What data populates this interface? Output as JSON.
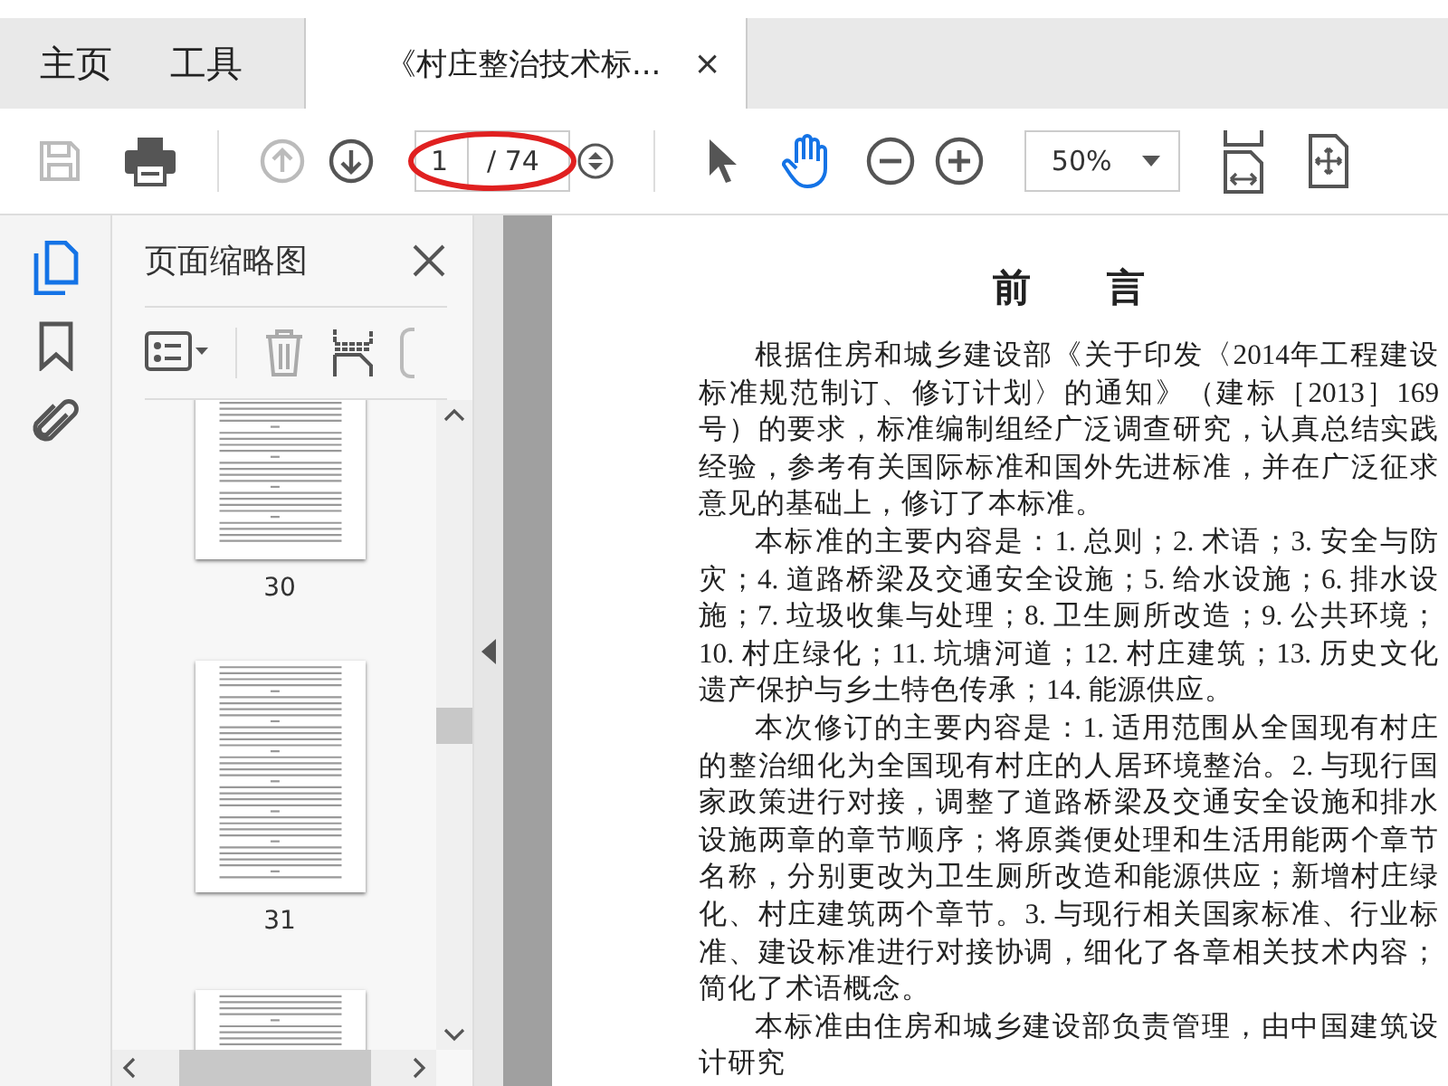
{
  "tabs": [
    {
      "label": "主页",
      "selected": false
    },
    {
      "label": "工具",
      "selected": false
    },
    {
      "label": "《村庄整治技术标...",
      "selected": true,
      "close": "×"
    }
  ],
  "toolbar": {
    "save": {
      "disabled": true
    },
    "prev_page": {
      "disabled": true
    },
    "next_page": {
      "disabled": false
    },
    "page_number": {
      "value": "1"
    },
    "page_count": "/ 74",
    "select_tool": {
      "selected": false
    },
    "hand_tool": {
      "selected": true
    },
    "zoom": {
      "value": "50%"
    }
  },
  "annotations": [
    {
      "kind": "ellipse"
    }
  ],
  "sidebar": {
    "items": [
      {
        "selected": true
      },
      {
        "selected": false
      },
      {
        "selected": false
      }
    ]
  },
  "thumbnail_panel": {
    "title": "页面缩略图",
    "thumbnails": [
      {
        "kind": "cut_top",
        "label": "30"
      },
      {
        "kind": "full",
        "label": "31"
      },
      {
        "kind": "cut_bottom"
      }
    ]
  },
  "document": {
    "title": "前　　言",
    "paragraphs": [
      "根据住房和城乡建设部《关于印发〈2014年工程建设标准规范制订、修订计划〉的通知》（建标［2013］169号）的要求，标准编制组经广泛调查研究，认真总结实践经验，参考有关国际标准和国外先进标准，并在广泛征求意见的基础上，修订了本标准。",
      "本标准的主要内容是：1. 总则；2. 术语；3. 安全与防灾；4. 道路桥梁及交通安全设施；5. 给水设施；6. 排水设施；7. 垃圾收集与处理；8. 卫生厕所改造；9. 公共环境；10. 村庄绿化；11. 坑塘河道；12. 村庄建筑；13. 历史文化遗产保护与乡土特色传承；14. 能源供应。",
      "本次修订的主要内容是：1. 适用范围从全国现有村庄的整治细化为全国现有村庄的人居环境整治。2. 与现行国家政策进行对接，调整了道路桥梁及交通安全设施和排水设施两章的章节顺序；将原粪便处理和生活用能两个章节名称，分别更改为卫生厕所改造和能源供应；新增村庄绿化、村庄建筑两个章节。3. 与现行相关国家标准、行业标准、建设标准进行对接协调，细化了各章相关技术内容；简化了术语概念。",
      "本标准由住房和城乡建设部负责管理，由中国建筑设计研究"
    ]
  }
}
